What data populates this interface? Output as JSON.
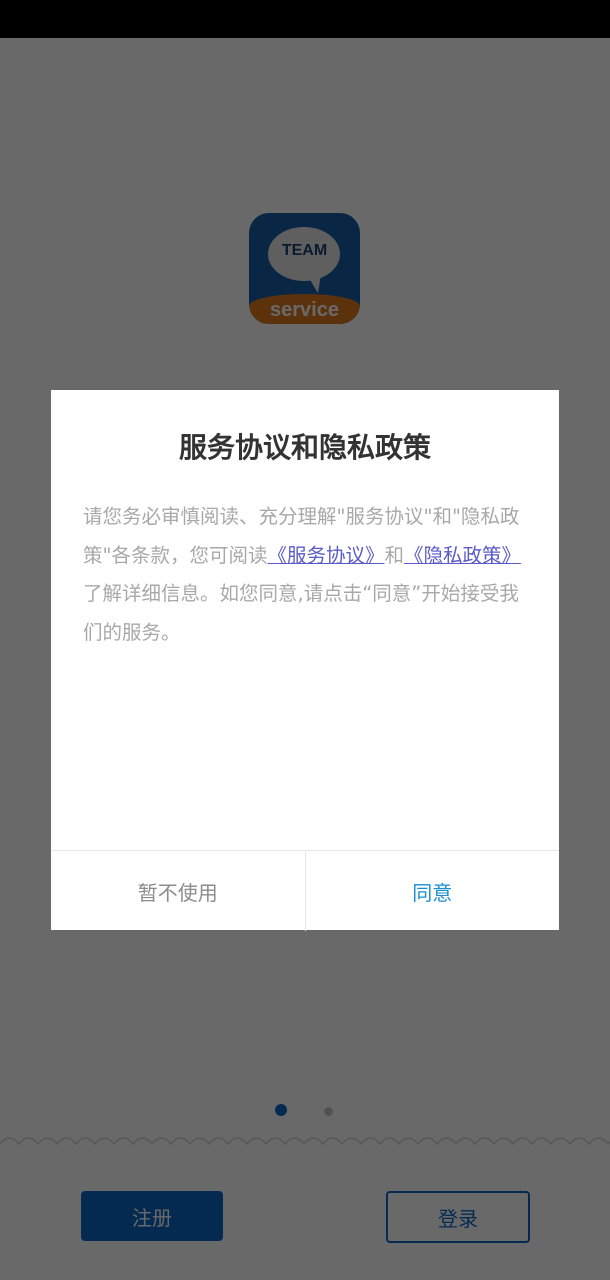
{
  "app": {
    "logo": {
      "top_text": "TEAM",
      "bottom_text": "service"
    },
    "pager": {
      "pages": 2,
      "active_index": 0
    },
    "buttons": {
      "register": "注册",
      "login": "登录"
    }
  },
  "dialog": {
    "title": "服务协议和隐私政策",
    "body": {
      "part1": "请您务必审慎阅读、充分理解\"服务协议\"和\"隐私政策\"各条款，您可阅读",
      "link_service": "《服务协议》",
      "part2": "和",
      "link_privacy": "《隐私政策》",
      "part3": "了解详细信息。如您同意,请点击“同意”开始接受我们的服务。"
    },
    "cancel_label": "暂不使用",
    "agree_label": "同意"
  },
  "colors": {
    "brand_blue": "#0c67c8",
    "link": "#5a5ac8",
    "agree": "#1a8fd6",
    "logo_orange": "#e07a1e"
  }
}
